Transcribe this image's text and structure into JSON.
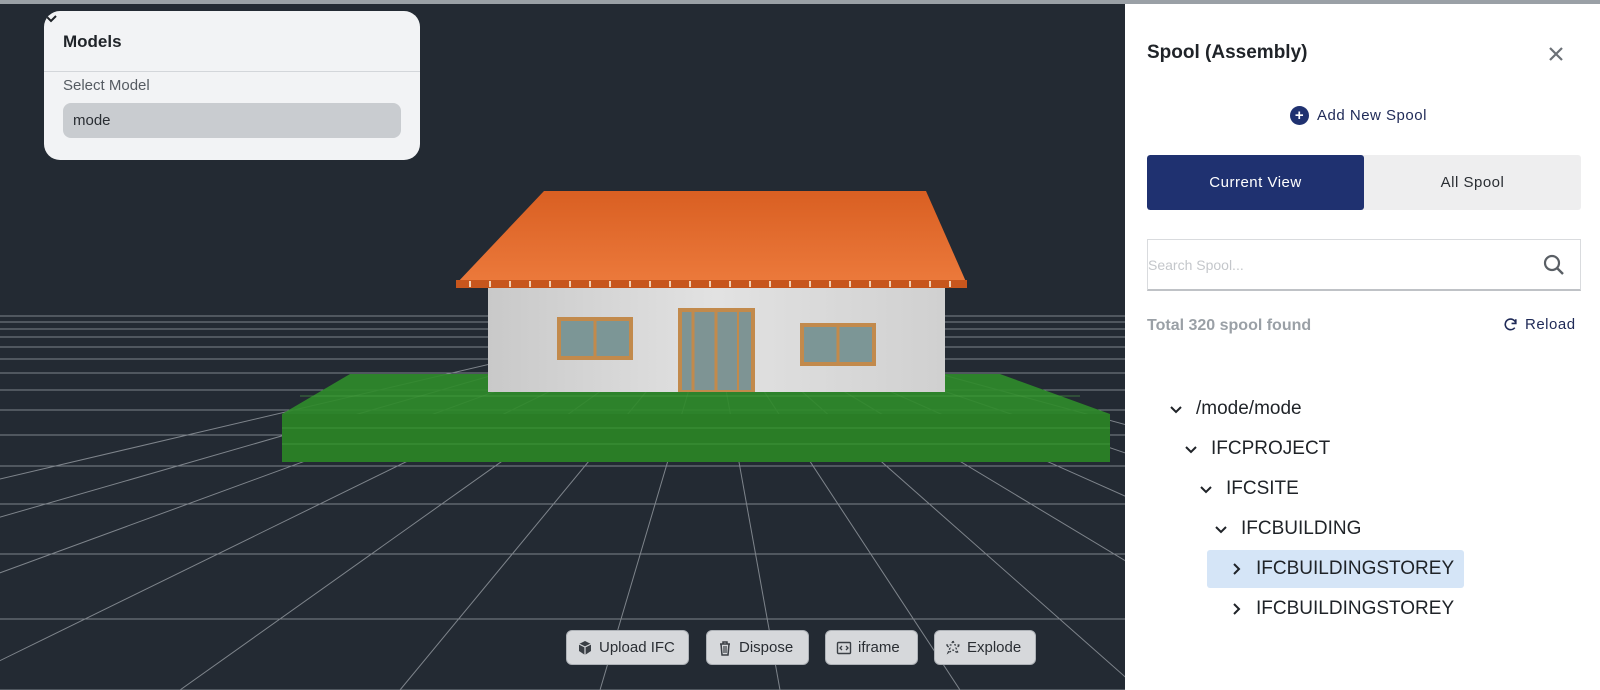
{
  "models": {
    "title": "Models",
    "select_label": "Select Model",
    "selected": "mode"
  },
  "toolbar": {
    "upload": "Upload IFC",
    "dispose": "Dispose",
    "iframe": "iframe",
    "explode": "Explode"
  },
  "panel": {
    "title": "Spool (Assembly)",
    "add_new": "Add New Spool",
    "tabs": [
      "Current View",
      "All Spool"
    ],
    "search_placeholder": "Search Spool...",
    "total_text": "Total 320 spool found",
    "reload": "Reload"
  },
  "tree": [
    {
      "label": "/mode/mode",
      "expanded": true
    },
    {
      "label": "IFCPROJECT",
      "expanded": true
    },
    {
      "label": "IFCSITE",
      "expanded": true
    },
    {
      "label": "IFCBUILDING",
      "expanded": true
    },
    {
      "label": "IFCBUILDINGSTOREY",
      "expanded": false,
      "selected": true
    },
    {
      "label": "IFCBUILDINGSTOREY",
      "expanded": false
    }
  ],
  "colors": {
    "accent": "#1f3170",
    "viewport_bg": "#232a33",
    "roof": "#e0662a",
    "ground": "#2f8a2a",
    "selected_row": "#d5e5f7"
  },
  "icons": {
    "upload": "cube-icon",
    "dispose": "trash-icon",
    "iframe": "code-frame-icon",
    "explode": "explode-icon",
    "close": "close-icon",
    "add": "plus-circle-icon",
    "search": "search-icon",
    "reload": "reload-icon"
  }
}
